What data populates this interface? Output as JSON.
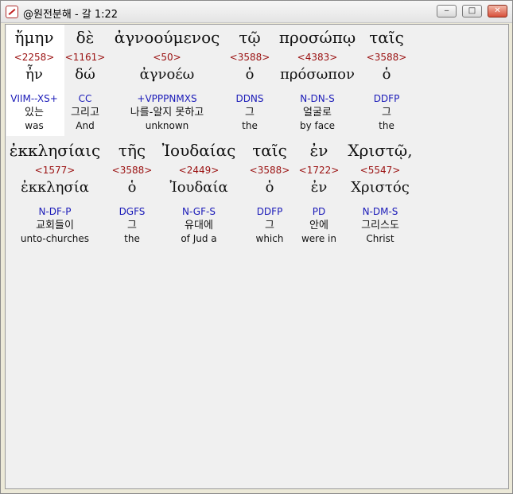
{
  "window": {
    "title": "@원전분해 - 갈 1:22",
    "minimize_glyph": "‒",
    "maximize_glyph": "□",
    "close_glyph": "✕"
  },
  "lines": [
    {
      "words": [
        {
          "greek": "ἤμην",
          "strong": "<2258>",
          "lemma": "ἦν",
          "parse": "VIIM--XS+",
          "korean": "있는",
          "english": "was"
        },
        {
          "greek": "δὲ",
          "strong": "<1161>",
          "lemma": "δώ",
          "parse": "CC",
          "korean": "그리고",
          "english": "And"
        },
        {
          "greek": "ἀγνοούμενος",
          "strong": "<50>",
          "lemma": "ἀγνοέω",
          "parse": "+VPPPNMXS",
          "korean": "나를-알지 못하고",
          "english": "unknown"
        },
        {
          "greek": "τῷ",
          "strong": "<3588>",
          "lemma": "ὁ",
          "parse": "DDNS",
          "korean": "그",
          "english": "the"
        },
        {
          "greek": "προσώπῳ",
          "strong": "<4383>",
          "lemma": "πρόσωπον",
          "parse": "N-DN-S",
          "korean": "얼굴로",
          "english": "by face"
        },
        {
          "greek": "ταῖς",
          "strong": "<3588>",
          "lemma": "ὁ",
          "parse": "DDFP",
          "korean": "그",
          "english": "the"
        }
      ]
    },
    {
      "words": [
        {
          "greek": "ἐκκλησίαις",
          "strong": "<1577>",
          "lemma": "ἐκκλησία",
          "parse": "N-DF-P",
          "korean": "교회들이",
          "english": "unto-churches"
        },
        {
          "greek": "τῆς",
          "strong": "<3588>",
          "lemma": "ὁ",
          "parse": "DGFS",
          "korean": "그",
          "english": "the"
        },
        {
          "greek": "Ἰουδαίας",
          "strong": "<2449>",
          "lemma": "Ἰουδαία",
          "parse": "N-GF-S",
          "korean": "유대에",
          "english": "of Jud a"
        },
        {
          "greek": "ταῖς",
          "strong": "<3588>",
          "lemma": "ὁ",
          "parse": "DDFP",
          "korean": "그",
          "english": "which"
        },
        {
          "greek": "ἐν",
          "strong": "<1722>",
          "lemma": "ἐν",
          "parse": "PD",
          "korean": "안에",
          "english": "were in"
        },
        {
          "greek": "Χριστῷ,",
          "strong": "<5547>",
          "lemma": "Χριστός",
          "parse": "N-DM-S",
          "korean": "그리스도",
          "english": "Christ"
        }
      ]
    }
  ]
}
